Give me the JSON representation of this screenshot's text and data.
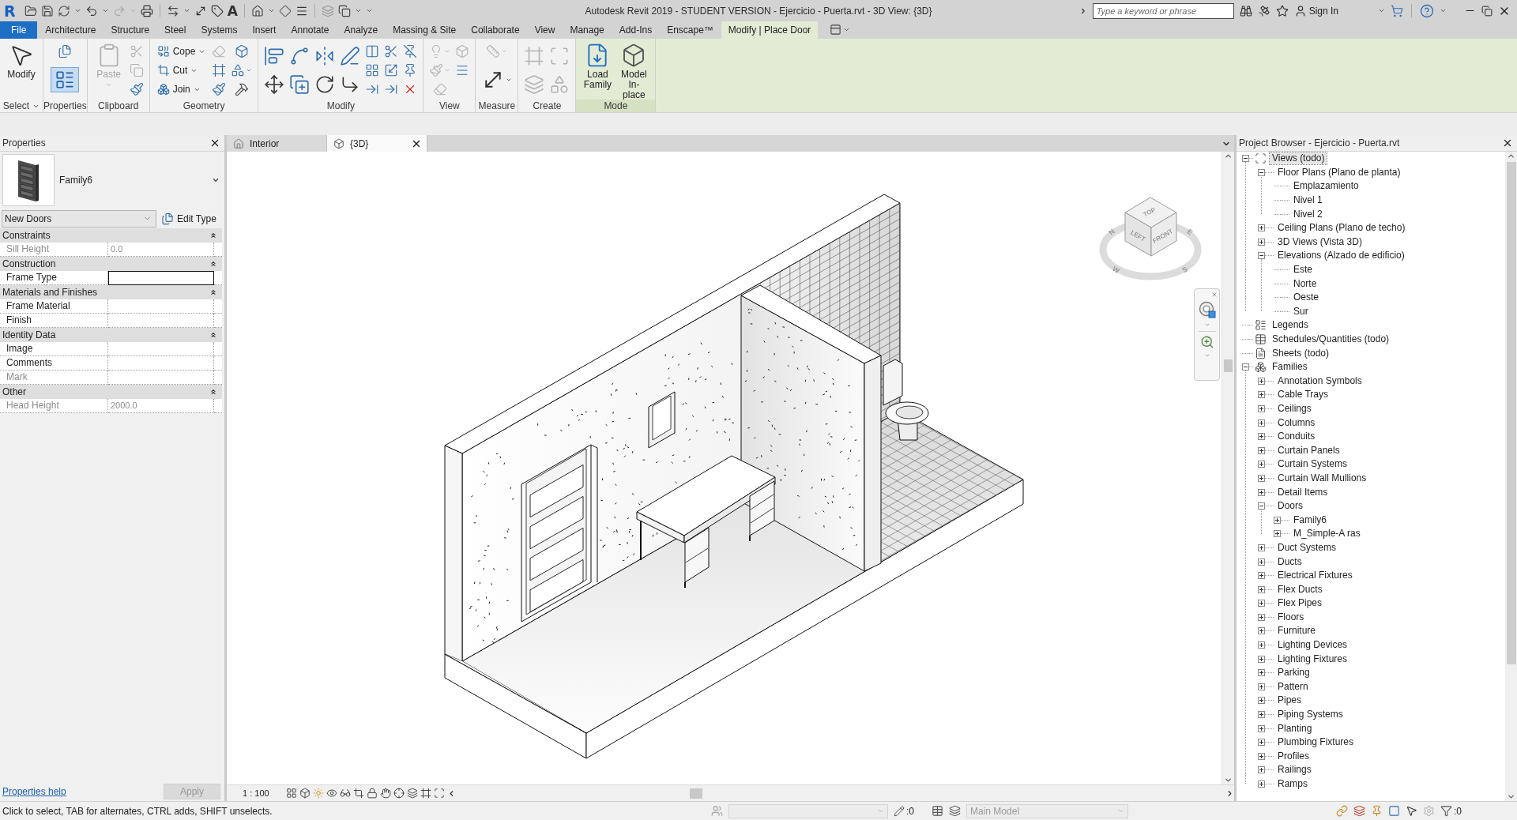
{
  "title_bar": {
    "logo": "R",
    "quick_access": {
      "redo": {
        "disabled": true
      },
      "text_tool": "A"
    },
    "title": "Autodesk Revit 2019 - STUDENT VERSION - Ejercicio - Puerta.rvt - 3D View: {3D}",
    "search": {
      "placeholder": "Type a keyword or phrase"
    },
    "sign_in": "Sign In"
  },
  "ribbon": {
    "tabs": [
      {
        "label": "File",
        "kind": "file",
        "selected": false
      },
      {
        "label": "Architecture",
        "kind": "standard",
        "selected": false
      },
      {
        "label": "Structure",
        "kind": "standard",
        "selected": false
      },
      {
        "label": "Steel",
        "kind": "standard",
        "selected": false
      },
      {
        "label": "Systems",
        "kind": "standard",
        "selected": false
      },
      {
        "label": "Insert",
        "kind": "standard",
        "selected": false
      },
      {
        "label": "Annotate",
        "kind": "standard",
        "selected": false
      },
      {
        "label": "Analyze",
        "kind": "standard",
        "selected": false
      },
      {
        "label": "Massing & Site",
        "kind": "standard",
        "selected": false
      },
      {
        "label": "Collaborate",
        "kind": "standard",
        "selected": false
      },
      {
        "label": "View",
        "kind": "standard",
        "selected": false
      },
      {
        "label": "Manage",
        "kind": "standard",
        "selected": false
      },
      {
        "label": "Add-Ins",
        "kind": "standard",
        "selected": false
      },
      {
        "label": "Enscape™",
        "kind": "standard",
        "selected": false
      },
      {
        "label": "Modify | Place Door",
        "kind": "contextual",
        "selected": true
      }
    ],
    "panels": [
      {
        "label": "Select",
        "dropdown": true,
        "contextual": false,
        "tools": [
          {
            "kind": "large",
            "label": "Modify",
            "disabled": false
          }
        ]
      },
      {
        "label": "Properties",
        "dropdown": false,
        "contextual": false,
        "tools": [
          {
            "kind": "small",
            "disabled": false,
            "on": false
          },
          {
            "kind": "tall",
            "disabled": false,
            "on": true
          }
        ]
      },
      {
        "label": "Clipboard",
        "dropdown": false,
        "contextual": false,
        "tools": [
          {
            "kind": "large",
            "label": "Paste",
            "disabled": true,
            "dropdown": true
          },
          {
            "kind": "small",
            "disabled": true
          },
          {
            "kind": "small",
            "disabled": true
          },
          {
            "kind": "small",
            "disabled": false
          }
        ]
      },
      {
        "label": "Geometry",
        "dropdown": false,
        "contextual": false,
        "tools": [
          {
            "kind": "split",
            "label": "Cope",
            "disabled": false
          },
          {
            "kind": "split",
            "label": "Cut",
            "disabled": false
          },
          {
            "kind": "split",
            "label": "Join",
            "disabled": false
          },
          {
            "kind": "small",
            "disabled": true
          },
          {
            "kind": "small",
            "disabled": false
          },
          {
            "kind": "small",
            "disabled": false
          },
          {
            "kind": "small",
            "disabled": false
          },
          {
            "kind": "small",
            "disabled": false,
            "dropdown": true
          },
          {
            "kind": "small",
            "disabled": false
          }
        ]
      },
      {
        "label": "Modify",
        "dropdown": false,
        "contextual": false,
        "tools": [
          {
            "kind": "medium",
            "disabled": false
          },
          {
            "kind": "medium",
            "disabled": false
          },
          {
            "kind": "medium",
            "disabled": false
          },
          {
            "kind": "medium",
            "disabled": false
          },
          {
            "kind": "medium",
            "disabled": false
          },
          {
            "kind": "medium",
            "disabled": false
          },
          {
            "kind": "medium",
            "disabled": false
          },
          {
            "kind": "medium",
            "disabled": false
          },
          {
            "kind": "small",
            "disabled": false
          },
          {
            "kind": "small",
            "disabled": false
          },
          {
            "kind": "small",
            "disabled": false
          },
          {
            "kind": "small",
            "disabled": false
          },
          {
            "kind": "small",
            "disabled": false
          },
          {
            "kind": "small",
            "disabled": false
          },
          {
            "kind": "small",
            "disabled": false
          },
          {
            "kind": "small",
            "disabled": false
          },
          {
            "kind": "small",
            "disabled": false
          }
        ]
      },
      {
        "label": "View",
        "dropdown": false,
        "contextual": false,
        "tools": [
          {
            "kind": "small",
            "disabled": true,
            "dropdown": true
          },
          {
            "kind": "small",
            "disabled": true,
            "dropdown": true
          },
          {
            "kind": "small",
            "disabled": true
          },
          {
            "kind": "small",
            "disabled": true
          },
          {
            "kind": "small",
            "disabled": false
          }
        ]
      },
      {
        "label": "Measure",
        "dropdown": false,
        "contextual": false,
        "tools": [
          {
            "kind": "small",
            "disabled": true,
            "dropdown": true
          },
          {
            "kind": "tall",
            "disabled": false,
            "dropdown": true
          }
        ]
      },
      {
        "label": "Create",
        "dropdown": false,
        "contextual": false,
        "tools": [
          {
            "kind": "medium",
            "disabled": true
          },
          {
            "kind": "medium",
            "disabled": true
          },
          {
            "kind": "medium",
            "disabled": true
          },
          {
            "kind": "medium",
            "disabled": true
          }
        ]
      },
      {
        "label": "Mode",
        "dropdown": false,
        "contextual": true,
        "tools": [
          {
            "kind": "large",
            "label": "Load Family",
            "disabled": false
          },
          {
            "kind": "large",
            "label": "Model In-place",
            "disabled": false
          }
        ]
      }
    ]
  },
  "properties_panel": {
    "title": "Properties",
    "type_selector": {
      "family": "Family6"
    },
    "type_dropdown": {
      "value": "New Doors"
    },
    "edit_type": "Edit Type",
    "groups": [
      {
        "name": "Constraints",
        "expanded": true,
        "rows": [
          {
            "label": "Sill Height",
            "value": "0.0",
            "disabled": true,
            "editing": false
          }
        ]
      },
      {
        "name": "Construction",
        "expanded": true,
        "rows": [
          {
            "label": "Frame Type",
            "disabled": false,
            "editing": true
          }
        ]
      },
      {
        "name": "Materials and Finishes",
        "expanded": true,
        "rows": [
          {
            "label": "Frame Material",
            "disabled": false,
            "editing": false
          },
          {
            "label": "Finish",
            "disabled": false,
            "editing": false
          }
        ]
      },
      {
        "name": "Identity Data",
        "expanded": true,
        "rows": [
          {
            "label": "Image",
            "disabled": false,
            "editing": false
          },
          {
            "label": "Comments",
            "disabled": false,
            "editing": false
          },
          {
            "label": "Mark",
            "disabled": true,
            "editing": false
          }
        ]
      },
      {
        "name": "Other",
        "expanded": true,
        "rows": [
          {
            "label": "Head Height",
            "value": "2000.0",
            "disabled": true,
            "editing": false
          }
        ]
      }
    ],
    "help_link": "Properties help",
    "apply_button": {
      "label": "Apply",
      "disabled": true
    }
  },
  "view_tabs": [
    {
      "label": "Interior",
      "kind": "plan",
      "selected": false
    },
    {
      "label": "{3D}",
      "kind": "model",
      "selected": true
    }
  ],
  "viewport": {
    "view_cube": {
      "faces": [
        "TOP",
        "LEFT",
        "FRONT"
      ],
      "compass": [
        "N",
        "E",
        "S",
        "W"
      ]
    }
  },
  "view_control_bar": {
    "scale": "1 : 100"
  },
  "project_browser": {
    "title": "Project Browser - Ejercicio - Puerta.rvt",
    "tree": [
      {
        "label": "Views (todo)",
        "selected": true,
        "expanded": true,
        "children": [
          {
            "label": "Floor Plans (Plano de planta)",
            "selected": false,
            "expanded": true,
            "children": [
              {
                "label": "Emplazamiento",
                "selected": false
              },
              {
                "label": "Nivel 1",
                "selected": false
              },
              {
                "label": "Nivel 2",
                "selected": false
              }
            ]
          },
          {
            "label": "Ceiling Plans (Plano de techo)",
            "selected": false,
            "expanded": false
          },
          {
            "label": "3D Views (Vista 3D)",
            "selected": false,
            "expanded": false
          },
          {
            "label": "Elevations (Alzado de edificio)",
            "selected": false,
            "expanded": true,
            "children": [
              {
                "label": "Este",
                "selected": false
              },
              {
                "label": "Norte",
                "selected": false
              },
              {
                "label": "Oeste",
                "selected": false
              },
              {
                "label": "Sur",
                "selected": false
              }
            ]
          }
        ]
      },
      {
        "label": "Legends",
        "selected": false
      },
      {
        "label": "Schedules/Quantities (todo)",
        "selected": false
      },
      {
        "label": "Sheets (todo)",
        "selected": false
      },
      {
        "label": "Families",
        "selected": false,
        "expanded": true,
        "children": [
          {
            "label": "Annotation Symbols",
            "selected": false,
            "expanded": false
          },
          {
            "label": "Cable Trays",
            "selected": false,
            "expanded": false
          },
          {
            "label": "Ceilings",
            "selected": false,
            "expanded": false
          },
          {
            "label": "Columns",
            "selected": false,
            "expanded": false
          },
          {
            "label": "Conduits",
            "selected": false,
            "expanded": false
          },
          {
            "label": "Curtain Panels",
            "selected": false,
            "expanded": false
          },
          {
            "label": "Curtain Systems",
            "selected": false,
            "expanded": false
          },
          {
            "label": "Curtain Wall Mullions",
            "selected": false,
            "expanded": false
          },
          {
            "label": "Detail Items",
            "selected": false,
            "expanded": false
          },
          {
            "label": "Doors",
            "selected": false,
            "expanded": true,
            "children": [
              {
                "label": "Family6",
                "selected": false,
                "expanded": false
              },
              {
                "label": "M_Simple-A ras",
                "selected": false,
                "expanded": false
              }
            ]
          },
          {
            "label": "Duct Systems",
            "selected": false,
            "expanded": false
          },
          {
            "label": "Ducts",
            "selected": false,
            "expanded": false
          },
          {
            "label": "Electrical Fixtures",
            "selected": false,
            "expanded": false
          },
          {
            "label": "Flex Ducts",
            "selected": false,
            "expanded": false
          },
          {
            "label": "Flex Pipes",
            "selected": false,
            "expanded": false
          },
          {
            "label": "Floors",
            "selected": false,
            "expanded": false
          },
          {
            "label": "Furniture",
            "selected": false,
            "expanded": false
          },
          {
            "label": "Lighting Devices",
            "selected": false,
            "expanded": false
          },
          {
            "label": "Lighting Fixtures",
            "selected": false,
            "expanded": false
          },
          {
            "label": "Parking",
            "selected": false,
            "expanded": false
          },
          {
            "label": "Pattern",
            "selected": false,
            "expanded": false
          },
          {
            "label": "Pipes",
            "selected": false,
            "expanded": false
          },
          {
            "label": "Piping Systems",
            "selected": false,
            "expanded": false
          },
          {
            "label": "Planting",
            "selected": false,
            "expanded": false
          },
          {
            "label": "Plumbing Fixtures",
            "selected": false,
            "expanded": false
          },
          {
            "label": "Profiles",
            "selected": false,
            "expanded": false
          },
          {
            "label": "Railings",
            "selected": false,
            "expanded": false
          },
          {
            "label": "Ramps",
            "selected": false,
            "expanded": false
          }
        ]
      }
    ]
  },
  "status_bar": {
    "message": "Click to select, TAB for alternates, CTRL adds, SHIFT unselects.",
    "workset": {
      "disabled": true
    },
    "editable_count": ":0",
    "design_option": {
      "value": "Main Model",
      "disabled": true
    },
    "filter_count": ":0"
  }
}
